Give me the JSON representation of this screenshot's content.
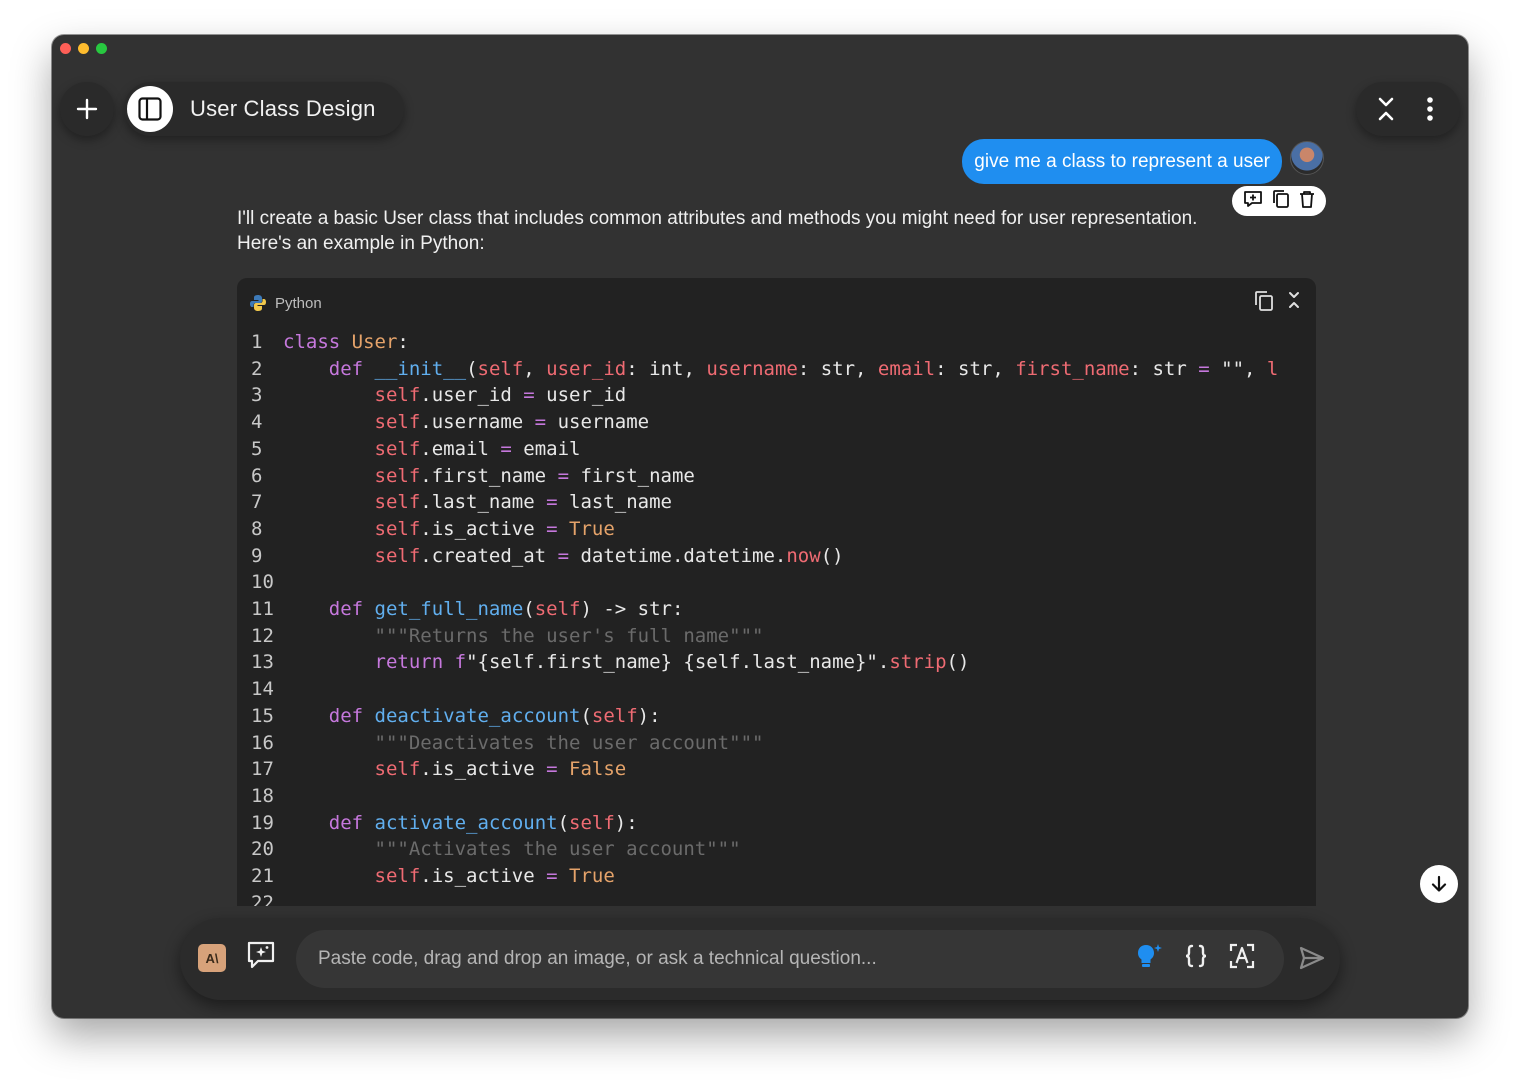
{
  "window": {
    "title": "User Class Design"
  },
  "user_message": {
    "text": "give me a class to represent a user"
  },
  "assistant": {
    "intro_line1": "I'll create a basic User class that includes common attributes and methods you might need for user representation.",
    "intro_line2": "Here's an example in Python:"
  },
  "code_block": {
    "language": "Python",
    "lines": [
      "class User:",
      "    def __init__(self, user_id: int, username: str, email: str, first_name: str = \"\", l",
      "        self.user_id = user_id",
      "        self.username = username",
      "        self.email = email",
      "        self.first_name = first_name",
      "        self.last_name = last_name",
      "        self.is_active = True",
      "        self.created_at = datetime.datetime.now()",
      "",
      "    def get_full_name(self) -> str:",
      "        \"\"\"Returns the user's full name\"\"\"",
      "        return f\"{self.first_name} {self.last_name}\".strip()",
      "",
      "    def deactivate_account(self):",
      "        \"\"\"Deactivates the user account\"\"\"",
      "        self.is_active = False",
      "",
      "    def activate_account(self):",
      "        \"\"\"Activates the user account\"\"\"",
      "        self.is_active = True",
      ""
    ]
  },
  "input": {
    "placeholder": "Paste code, drag and drop an image, or ask a technical question...",
    "value": ""
  },
  "badge": {
    "label": "A\\"
  },
  "colors": {
    "window_bg": "#323232",
    "code_bg": "#222222",
    "accent": "#1f8ef0",
    "keyword": "#c678dd",
    "function": "#61afef",
    "self": "#ef6b73",
    "literal": "#e5a36a",
    "comment": "#6b6b6b"
  },
  "icons": {
    "new": "plus-icon",
    "sidebar": "sidebar-icon",
    "collapse": "collapse-icon",
    "more": "more-vertical-icon",
    "edit": "add-note-icon",
    "copy": "copy-icon",
    "delete": "trash-icon",
    "python": "python-logo-icon",
    "scroll": "arrow-down-icon",
    "canvas": "canvas-icon",
    "idea": "lightbulb-icon",
    "code": "braces-icon",
    "text": "text-recognition-icon",
    "send": "send-icon"
  }
}
